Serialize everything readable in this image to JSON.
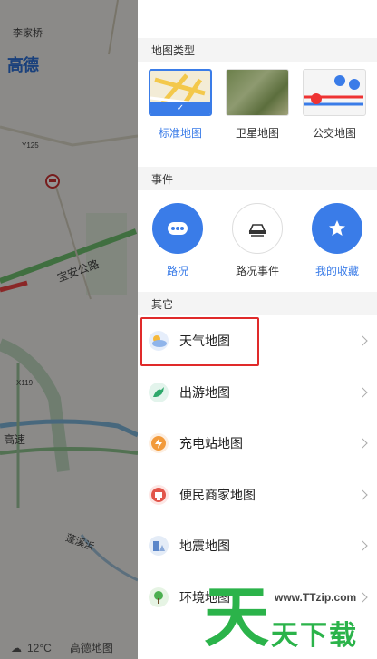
{
  "map": {
    "labels": [
      "李家桥",
      "Y125",
      "宝安公路",
      "X119",
      "高速",
      "蓬溪浜"
    ],
    "logo": "高德",
    "temperature": "12°C",
    "brand": "高德地图"
  },
  "map_type": {
    "title": "地图类型",
    "items": [
      {
        "label": "标准地图",
        "selected": true
      },
      {
        "label": "卫星地图",
        "selected": false
      },
      {
        "label": "公交地图",
        "selected": false
      }
    ]
  },
  "events": {
    "title": "事件",
    "items": [
      {
        "label": "路况",
        "icon": "traffic-dots-icon"
      },
      {
        "label": "路况事件",
        "icon": "car-accident-icon"
      },
      {
        "label": "我的收藏",
        "icon": "star-icon"
      }
    ]
  },
  "other": {
    "title": "其它",
    "items": [
      {
        "label": "天气地图",
        "icon": "weather-icon"
      },
      {
        "label": "出游地图",
        "icon": "travel-icon"
      },
      {
        "label": "充电站地图",
        "icon": "charging-icon"
      },
      {
        "label": "便民商家地图",
        "icon": "merchant-icon"
      },
      {
        "label": "地震地图",
        "icon": "earthquake-icon"
      },
      {
        "label": "环境地图",
        "icon": "environment-icon"
      }
    ]
  },
  "watermark": {
    "big_char": "天",
    "url": "www.TTzip.com",
    "text": "天下载"
  },
  "colors": {
    "accent": "#3a7ce8",
    "highlight": "#e02a2a",
    "watermark": "#2bb34a"
  }
}
